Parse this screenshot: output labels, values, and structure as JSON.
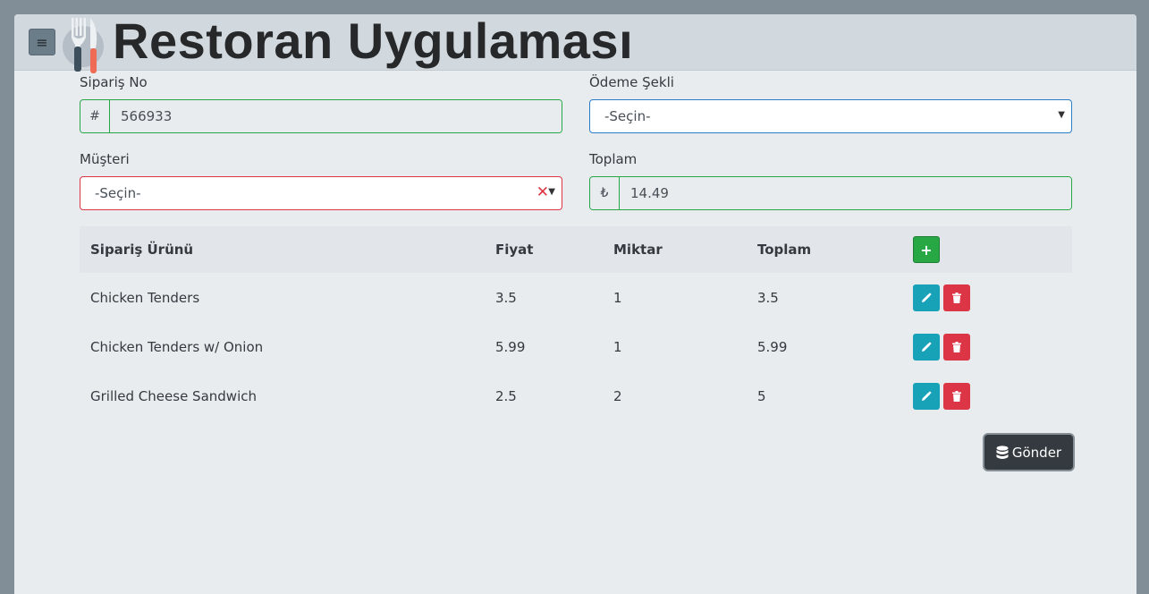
{
  "header": {
    "title": "Restoran Uygulaması",
    "menu_icon": "hamburger-icon",
    "logo_icon": "fork-knife-icon"
  },
  "form": {
    "order_no": {
      "label": "Sipariş No",
      "prefix": "#",
      "value": "566933"
    },
    "payment_method": {
      "label": "Ödeme Şekli",
      "value": "-Seçin-"
    },
    "customer": {
      "label": "Müşteri",
      "value": "-Seçin-"
    },
    "total": {
      "label": "Toplam",
      "prefix": "₺",
      "value": "14.49"
    }
  },
  "table": {
    "headers": [
      "Sipariş Ürünü",
      "Fiyat",
      "Miktar",
      "Toplam"
    ],
    "rows": [
      {
        "product": "Chicken Tenders",
        "price": "3.5",
        "qty": "1",
        "total": "3.5"
      },
      {
        "product": "Chicken Tenders w/ Onion",
        "price": "5.99",
        "qty": "1",
        "total": "5.99"
      },
      {
        "product": "Grilled Cheese Sandwich",
        "price": "2.5",
        "qty": "2",
        "total": "5"
      }
    ]
  },
  "actions": {
    "submit_label": "Gönder"
  },
  "colors": {
    "success": "#28a745",
    "info": "#17a2b8",
    "danger": "#dc3545",
    "dark": "#343a40"
  }
}
